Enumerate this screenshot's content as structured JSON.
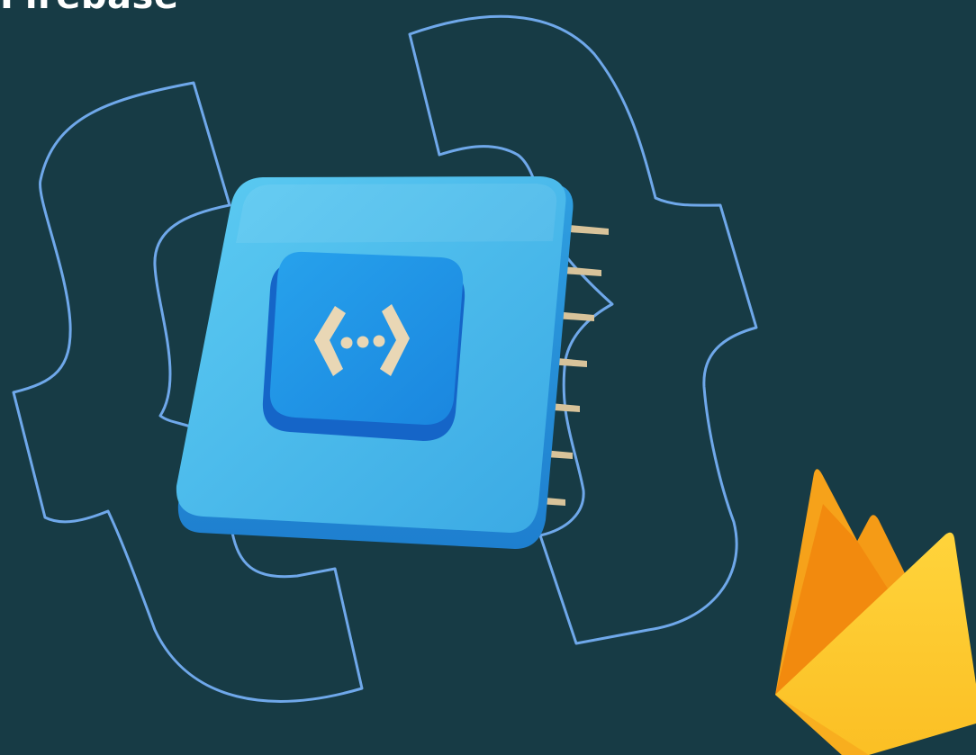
{
  "header": {
    "title": "Firebase"
  },
  "illustration": {
    "chip_icon": "cloud-functions-icon",
    "logo_icon": "firebase-flame-icon",
    "decor_icon": "curly-braces-outline-icon"
  },
  "colors": {
    "background": "#173b45",
    "outline": "#6fa8ea",
    "chip": "#3fb6ea",
    "chip_button": "#1e88e5",
    "icon_glyph": "#e9d7b5",
    "pins": "#d8c39a",
    "flame_orange": "#f6a21a",
    "flame_yellow": "#fdca2e"
  }
}
